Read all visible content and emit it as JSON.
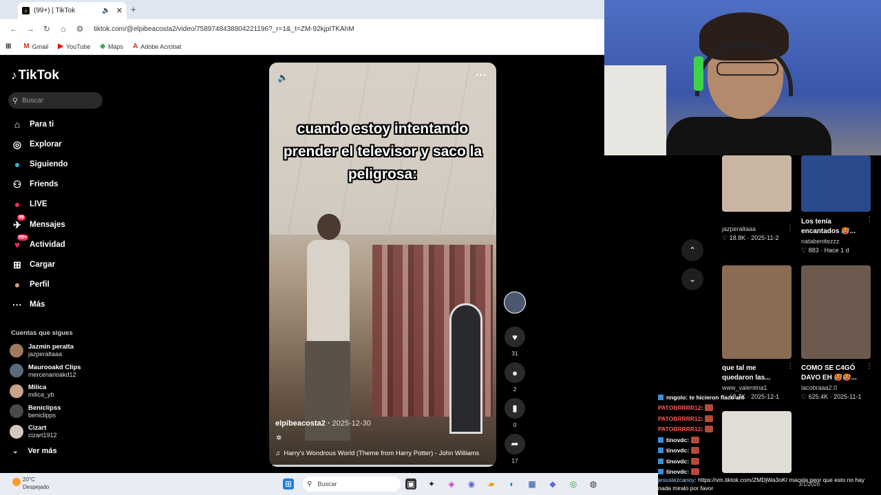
{
  "browser": {
    "tab_title": "(99+) | TikTok",
    "url": "tiktok.com/@elpibeacosta2/video/7589748438804221196?_r=1&_t=ZM-92kjpITKAhM",
    "bookmarks": [
      {
        "label": "Gmail",
        "icon": "gmail-icon",
        "glyph": "M",
        "color": "#d93025"
      },
      {
        "label": "YouTube",
        "icon": "youtube-icon",
        "glyph": "▶",
        "color": "#ff0000"
      },
      {
        "label": "Maps",
        "icon": "maps-icon",
        "glyph": "◆",
        "color": "#34a853"
      },
      {
        "label": "Adobe Acrobat",
        "icon": "acrobat-icon",
        "glyph": "A",
        "color": "#d4252b"
      }
    ]
  },
  "tiktok": {
    "logo": "TikTok",
    "search_placeholder": "Buscar",
    "nav": [
      {
        "label": "Para ti",
        "icon": "home-icon",
        "glyph": "⌂"
      },
      {
        "label": "Explorar",
        "icon": "compass-icon",
        "glyph": "◎"
      },
      {
        "label": "Siguiendo",
        "icon": "following-icon",
        "glyph": "●"
      },
      {
        "label": "Friends",
        "icon": "friends-icon",
        "glyph": "⚇"
      },
      {
        "label": "LIVE",
        "icon": "live-icon",
        "glyph": "●"
      },
      {
        "label": "Mensajes",
        "icon": "messages-icon",
        "glyph": "✈",
        "badge": "99"
      },
      {
        "label": "Actividad",
        "icon": "activity-icon",
        "glyph": "♥",
        "badge": "99+"
      },
      {
        "label": "Cargar",
        "icon": "upload-icon",
        "glyph": "⊞"
      },
      {
        "label": "Perfil",
        "icon": "profile-icon",
        "glyph": "●"
      },
      {
        "label": "Más",
        "icon": "more-icon",
        "glyph": "···"
      }
    ],
    "following_title": "Cuentas que sigues",
    "following": [
      {
        "name": "Jazmin peralta",
        "handle": "jazperaltaaa"
      },
      {
        "name": "Maurooakd Clips",
        "handle": "mercenarioakd12"
      },
      {
        "name": "Milica",
        "handle": "milica_yb"
      },
      {
        "name": "Beniclipss",
        "handle": "beniclipps"
      },
      {
        "name": "Cizart",
        "handle": "cizart1912"
      }
    ],
    "see_more": "Ver más"
  },
  "video": {
    "caption": "cuando estoy intentando prender el televisor y saco la peligrosa:",
    "author": "elpibeacosta2",
    "date": "2025-12-30",
    "music": "Harry's Wondrous World (Theme from Harry Potter) - John Williams",
    "likes": "31",
    "comments": "2",
    "saves": "0",
    "shares": "17"
  },
  "grid": [
    {
      "title": "",
      "user": "jazperaltaaa",
      "meta": "♡ 18.8K · 2025-11-2",
      "color": "#c9b6a2"
    },
    {
      "title": "Los tenía encantados 🥵...",
      "user": "natabenitezzz",
      "meta": "♡ 883 · Hace 1 d",
      "color": "#2b4a8c"
    },
    {
      "title": "que tal me quedaron las...",
      "user": "www_valentina1",
      "meta": "♡ 68.7K · 2025-12-1",
      "color": "#8a6c52"
    },
    {
      "title": "COMO SE C4GÓ DAVO EH 🥵🥵...",
      "user": "lacobraaa2.0",
      "meta": "♡ 625.4K · 2025-11-1",
      "color": "#6d5a4e"
    },
    {
      "title": "",
      "user": "",
      "meta": "",
      "color": "#e0dcd6"
    }
  ],
  "chat": {
    "lines": [
      {
        "user": "nngolo",
        "text": ": te hicieron flaco ahi",
        "color": "#ffffff"
      },
      {
        "user": "PATOBRRRR12",
        "text": ":",
        "color": "#ff5a5a"
      },
      {
        "user": "PATOBRRRR12",
        "text": ":",
        "color": "#ff5a5a"
      },
      {
        "user": "PATOBRRRR12",
        "text": ":",
        "color": "#ff5a5a"
      },
      {
        "user": "tinovdc",
        "text": ":",
        "color": "#ffffff"
      },
      {
        "user": "tinovdc",
        "text": ":",
        "color": "#ffffff"
      },
      {
        "user": "tinovdc",
        "text": ":",
        "color": "#ffffff"
      },
      {
        "user": "tinovdc",
        "text": ":",
        "color": "#ffffff"
      }
    ],
    "bottom_user": "jesuslezcanoy",
    "bottom_text": ": https://vm.tiktok.com/ZMDjWa3oK/ macela peor que esto no hay nada miralo por favor"
  },
  "taskbar": {
    "temp": "20°C",
    "weather": "Despejado",
    "search": "Buscar",
    "date": "3/1/2026"
  }
}
